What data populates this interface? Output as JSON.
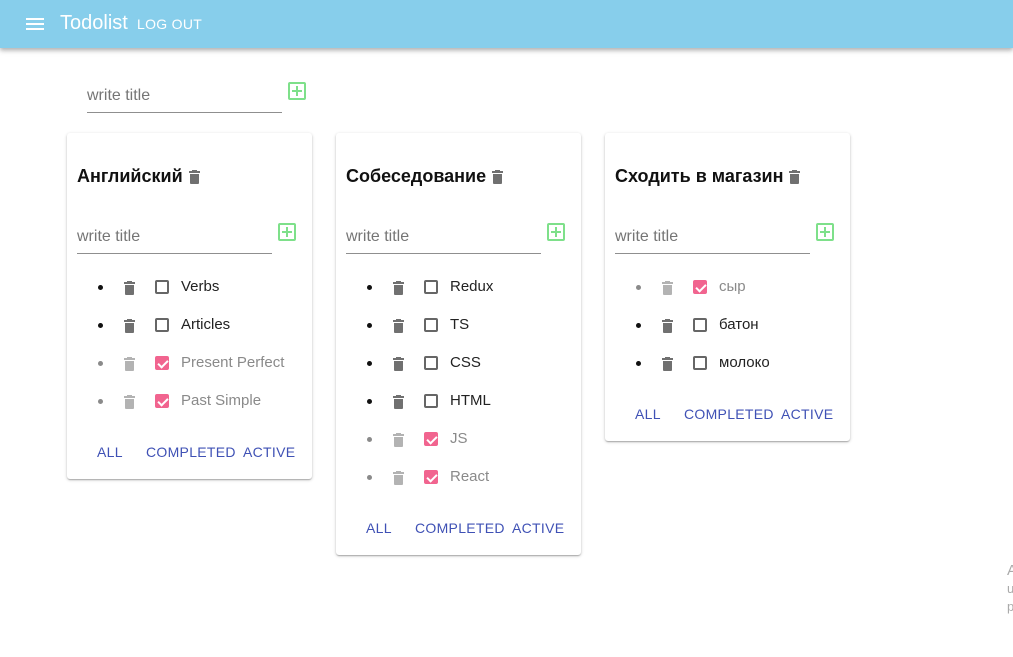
{
  "app": {
    "title": "Todolist",
    "logout_label": "LOG OUT"
  },
  "add_list": {
    "placeholder": "write title"
  },
  "colors": {
    "appbar": "#87ceeb",
    "add_icon": "#7ee08a",
    "checkbox_checked": "#f1648f",
    "filter_link": "#3f51b5"
  },
  "icons": {
    "menu": "menu-icon",
    "delete": "trash-icon",
    "add": "add-box-icon"
  },
  "lists": [
    {
      "title": "Английский",
      "placeholder": "write title",
      "tasks": [
        {
          "label": "Verbs",
          "done": false
        },
        {
          "label": "Articles",
          "done": false
        },
        {
          "label": "Present Perfect",
          "done": true
        },
        {
          "label": "Past Simple",
          "done": true
        }
      ],
      "filters": {
        "all": "ALL",
        "completed": "COMPLETED",
        "active": "ACTIVE"
      }
    },
    {
      "title": "Собеседование",
      "placeholder": "write title",
      "tasks": [
        {
          "label": "Redux",
          "done": false
        },
        {
          "label": "TS",
          "done": false
        },
        {
          "label": "CSS",
          "done": false
        },
        {
          "label": "HTML",
          "done": false
        },
        {
          "label": "JS",
          "done": true
        },
        {
          "label": "React",
          "done": true
        }
      ],
      "filters": {
        "all": "ALL",
        "completed": "COMPLETED",
        "active": "ACTIVE"
      }
    },
    {
      "title": "Сходить в магазин",
      "placeholder": "write title",
      "tasks": [
        {
          "label": "сыр",
          "done": true
        },
        {
          "label": "батон",
          "done": false
        },
        {
          "label": "молоко",
          "done": false
        }
      ],
      "filters": {
        "all": "ALL",
        "completed": "COMPLETED",
        "active": "ACTIVE"
      }
    }
  ],
  "edge_clip": [
    "A",
    "u",
    "p"
  ]
}
